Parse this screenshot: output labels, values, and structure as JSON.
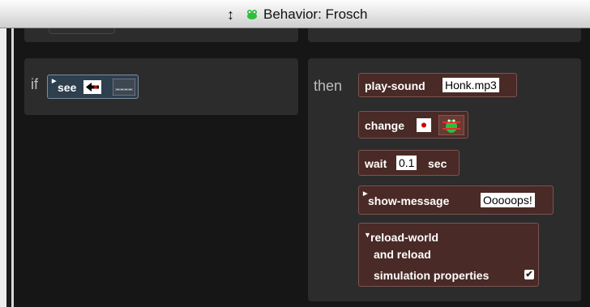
{
  "window": {
    "title": "Behavior: Frosch"
  },
  "rule": {
    "if_keyword": "if",
    "then_keyword": "then",
    "condition": {
      "label": "see"
    },
    "actions": {
      "play_sound": {
        "label": "play-sound",
        "value": "Honk.mp3"
      },
      "change": {
        "label": "change"
      },
      "wait": {
        "label": "wait",
        "value": "0.1",
        "unit": "sec"
      },
      "show_message": {
        "label": "show-message",
        "value": "Ooooops!"
      },
      "reload": {
        "line1": "reload-world",
        "line2": "and reload",
        "line3": "simulation properties",
        "checked": true
      }
    }
  },
  "icons": {
    "title": "frog-icon",
    "resize": "vertical-resize-icon",
    "see_direction": "arrow-left-icon",
    "see_agent": "road-tile-icon",
    "change_direction": "dot-icon",
    "change_agent": "frog-sprite-icon",
    "checkbox": "checkmark-icon"
  },
  "colors": {
    "titlebar_top": "#fdfdfd",
    "titlebar_bottom": "#cfcfcf",
    "canvas": "#161616",
    "panel": "#2c2c2c",
    "action_block": "#4a2a26",
    "condition_block": "#2e3f4e",
    "frog_green": "#2fbf3a"
  }
}
